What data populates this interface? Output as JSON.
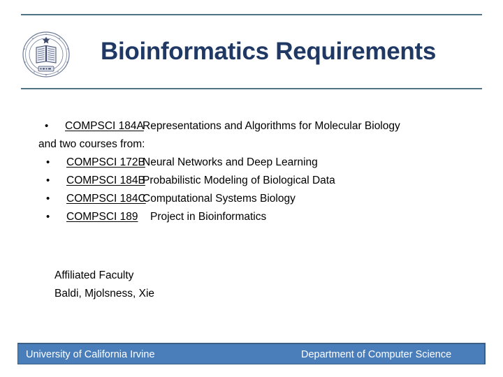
{
  "slide": {
    "title": "Bioinformatics Requirements",
    "logo_icon": "uc-seal-icon"
  },
  "requirements": {
    "required_course": {
      "bullet": "•",
      "code": "COMPSCI 184A",
      "name": "Representations and Algorithms for Molecular Biology"
    },
    "elective_intro": "and two courses from:",
    "electives": [
      {
        "bullet": "•",
        "code": "COMPSCI 172B",
        "name": "Neural Networks and Deep Learning"
      },
      {
        "bullet": "•",
        "code": "COMPSCI 184B",
        "name": "Probabilistic Modeling of Biological Data"
      },
      {
        "bullet": "•",
        "code": "COMPSCI 184C",
        "name": "Computational Systems Biology"
      },
      {
        "bullet": "•",
        "code": "COMPSCI 189",
        "name": "Project in Bioinformatics"
      }
    ]
  },
  "faculty": {
    "heading": "Affiliated Faculty",
    "names": "Baldi, Mjolsness, Xie"
  },
  "footer": {
    "left": "University of California Irvine",
    "right": "Department of Computer Science"
  },
  "colors": {
    "title": "#1F3864",
    "rule": "#4E7387",
    "footer_bar": "#4A7EBB",
    "footer_border": "#3A5F85",
    "footer_text": "#FFFFFF",
    "body_text": "#000000"
  }
}
